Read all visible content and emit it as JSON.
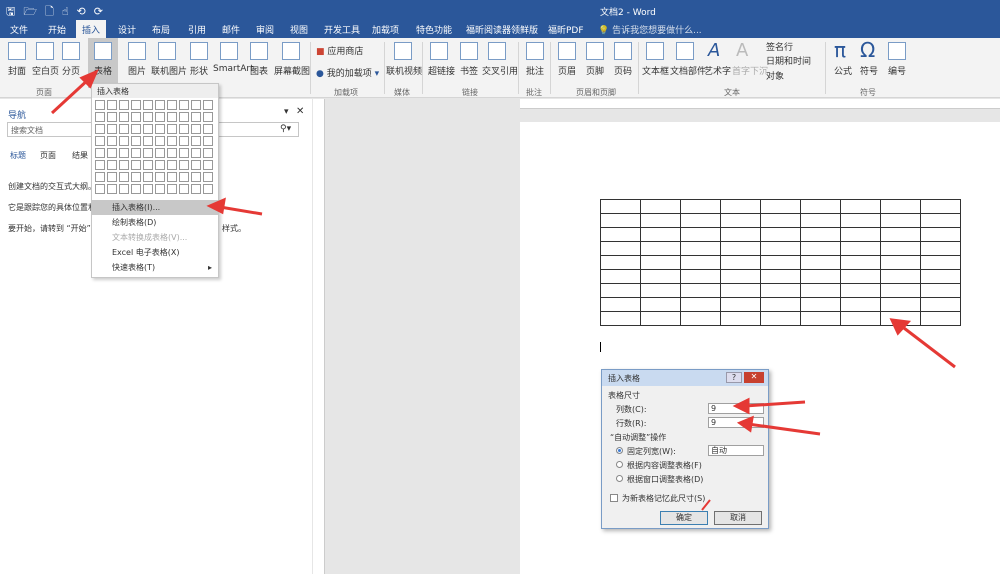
{
  "title": "文档2 - Word",
  "quick_access": [
    "save-icon",
    "open-icon",
    "new-icon",
    "touch-mode-icon",
    "spelling-icon",
    "print-preview-icon",
    "undo-icon",
    "redo-icon"
  ],
  "tabs": [
    "文件",
    "开始",
    "插入",
    "设计",
    "布局",
    "引用",
    "邮件",
    "审阅",
    "视图",
    "开发工具",
    "加载项",
    "特色功能",
    "福昕阅读器领鲜版",
    "福昕PDF"
  ],
  "active_tab": "插入",
  "tell_me": "告诉我您想要做什么...",
  "ribbon": {
    "items": [
      "封面",
      "空白页",
      "分页",
      "表格",
      "图片",
      "联机图片",
      "形状",
      "SmartArt",
      "图表",
      "屏幕截图",
      "联机视频",
      "超链接",
      "书签",
      "交叉引用",
      "批注",
      "页眉",
      "页脚",
      "页码",
      "文本框",
      "文档部件",
      "艺术字",
      "首字下沉",
      "公式",
      "符号",
      "编号"
    ],
    "addins": [
      "应用商店",
      "我的加载项"
    ],
    "text_small": [
      "签名行",
      "日期和时间",
      "对象"
    ],
    "groups": [
      "页面",
      "加载项",
      "媒体",
      "链接",
      "批注",
      "页眉和页脚",
      "文本",
      "符号"
    ]
  },
  "nav": {
    "title": "导航",
    "search_placeholder": "搜索文档",
    "tabs": [
      "标题",
      "页面",
      "结果"
    ],
    "lines": [
      "创建文档的交互式大纲。",
      "它是跟踪您的具体位置和",
      "要开始，请转到 “开始”",
      "样式。"
    ]
  },
  "dropdown": {
    "header": "插入表格",
    "menu": [
      "插入表格(I)...",
      "绘制表格(D)",
      "文本转换成表格(V)...",
      "Excel 电子表格(X)",
      "快速表格(T)"
    ]
  },
  "document_table": {
    "rows": 9,
    "cols": 9
  },
  "dialog": {
    "title": "插入表格",
    "help": "?",
    "close": "✕",
    "size_label": "表格尺寸",
    "cols_label": "列数(C):",
    "cols_value": "9",
    "rows_label": "行数(R):",
    "rows_value": "9",
    "autofit_label": "“自动调整”操作",
    "fixed": "固定列宽(W):",
    "fixed_value": "自动",
    "by_content": "根据内容调整表格(F)",
    "by_window": "根据窗口调整表格(D)",
    "remember": "为新表格记忆此尺寸(S)",
    "ok": "确定",
    "cancel": "取消"
  },
  "colors": {
    "brand": "#2b579a",
    "arrow": "#e53935"
  }
}
